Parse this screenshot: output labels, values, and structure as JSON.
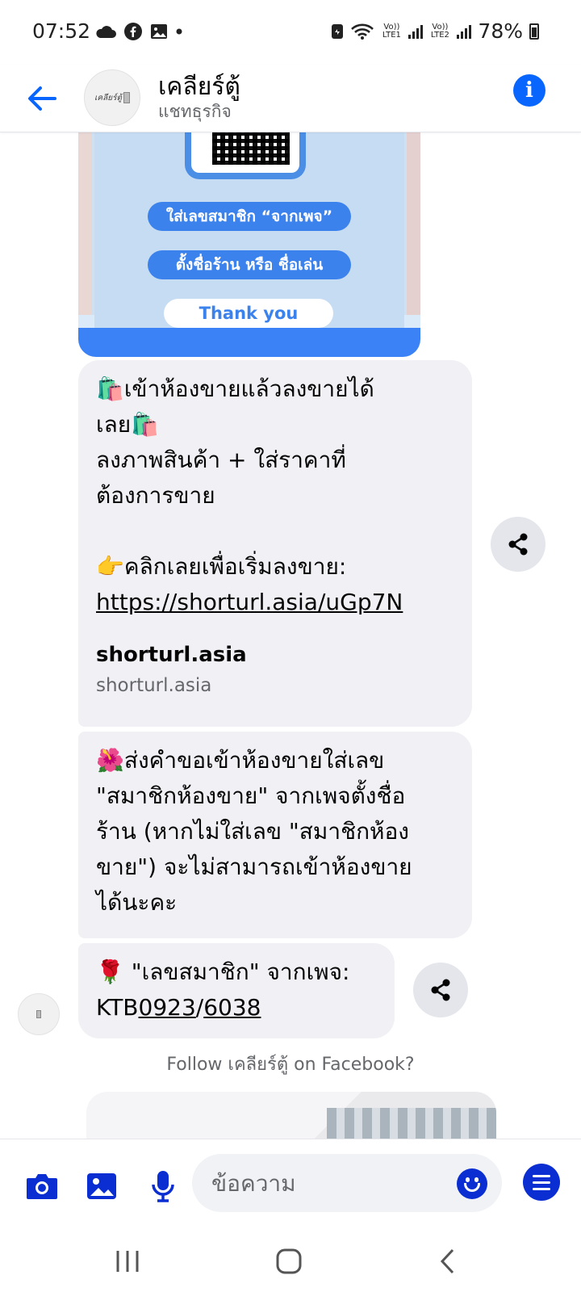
{
  "status_bar": {
    "time": "07:52",
    "battery": "78%",
    "sim1": "Vo)) LTE1",
    "sim2": "Vo)) LTE2"
  },
  "header": {
    "title": "เคลียร์ตู้",
    "subtitle": "แชทธุรกิจ",
    "avatar_text": "เคลียร์ตู้"
  },
  "image_card": {
    "pill_1": "ใส่เลขสมาชิก “จากเพจ”",
    "pill_2": "ตั้งชื่อร้าน หรือ ชื่อเล่น",
    "thanks": "Thank you"
  },
  "messages": {
    "m1": {
      "line1": "🛍️เข้าห้องขายแล้วลงขายได้",
      "line2": "เลย🛍️",
      "line3": "ลงภาพสินค้า + ใส่ราคาที่",
      "line4": "ต้องการขาย",
      "line5": "👉คลิกเลยเพื่อเริ่มลงขาย:",
      "link": "https://shorturl.asia/uGp7N",
      "preview_title": "shorturl.asia",
      "preview_domain": "shorturl.asia"
    },
    "m2": {
      "line1": "🌺ส่งคำขอเข้าห้องขายใส่เลข",
      "line2": "\"สมาชิกห้องขาย\" จากเพจตั้งชื่อ",
      "line3": "ร้าน (หากไม่ใส่เลข \"สมาชิกห้อง",
      "line4": "ขาย\") จะไม่สามารถเข้าห้องขาย",
      "line5": "ได้นะคะ"
    },
    "m3": {
      "line1": "🌹 \"เลขสมาชิก\" จากเพจ:",
      "code_prefix": "KTB",
      "code_part1": "0923",
      "code_sep": "/",
      "code_part2": "6038"
    }
  },
  "follow_prompt": "Follow เคลียร์ตู้ on Facebook?",
  "composer": {
    "placeholder": "ข้อความ"
  },
  "colors": {
    "accent": "#0866ff",
    "composer_icon": "#0a2ed1",
    "bubble": "#f0f0f5",
    "muted_text": "#65676b"
  },
  "icons": [
    "back-arrow-icon",
    "info-icon",
    "share-icon",
    "camera-icon",
    "image-icon",
    "microphone-icon",
    "smiley-icon",
    "menu-icon",
    "recents-icon",
    "home-icon",
    "back-icon"
  ]
}
